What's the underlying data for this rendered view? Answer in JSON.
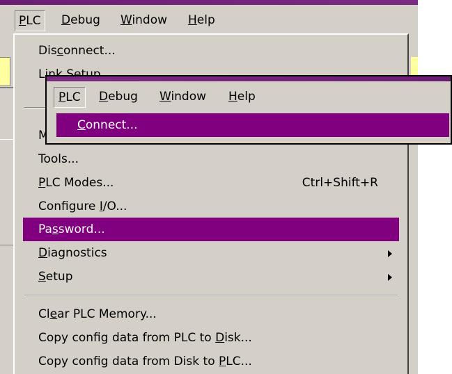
{
  "menubar": {
    "items": [
      {
        "pre": "",
        "ul": "P",
        "post": "LC"
      },
      {
        "pre": "",
        "ul": "D",
        "post": "ebug"
      },
      {
        "pre": "",
        "ul": "W",
        "post": "indow"
      },
      {
        "pre": "",
        "ul": "H",
        "post": "elp"
      }
    ]
  },
  "plc_menu": {
    "items": [
      {
        "pre": "Dis",
        "ul": "c",
        "post": "onnect..."
      },
      {
        "pre": "Li",
        "ul": "n",
        "post": "k Setup..."
      },
      {
        "pre": "",
        "ul": "",
        "post": "M"
      },
      {
        "pre": "Tools...",
        "ul": "",
        "post": ""
      },
      {
        "pre": "",
        "ul": "P",
        "post": "LC Modes...",
        "shortcut": "Ctrl+Shift+R"
      },
      {
        "pre": "Configure ",
        "ul": "I",
        "post": "/O..."
      },
      {
        "pre": "Pa",
        "ul": "s",
        "post": "sword...",
        "highlighted": true
      },
      {
        "pre": "",
        "ul": "D",
        "post": "iagnostics",
        "submenu": true
      },
      {
        "pre": "",
        "ul": "S",
        "post": "etup",
        "submenu": true
      },
      {
        "pre": "Cl",
        "ul": "e",
        "post": "ar PLC Memory..."
      },
      {
        "pre": "Copy config data from PLC to ",
        "ul": "D",
        "post": "isk..."
      },
      {
        "pre": "Copy config data from Disk to ",
        "ul": "P",
        "post": "LC..."
      }
    ]
  },
  "inset": {
    "menubar": [
      {
        "pre": "",
        "ul": "P",
        "post": "LC"
      },
      {
        "pre": "",
        "ul": "D",
        "post": "ebug"
      },
      {
        "pre": "",
        "ul": "W",
        "post": "indow"
      },
      {
        "pre": "",
        "ul": "H",
        "post": "elp"
      }
    ],
    "highlighted_item": {
      "pre": "",
      "ul": "C",
      "post": "onnect..."
    }
  },
  "colors": {
    "highlight": "#800080",
    "face": "#d4d0c8",
    "title": "#6a1e73"
  }
}
